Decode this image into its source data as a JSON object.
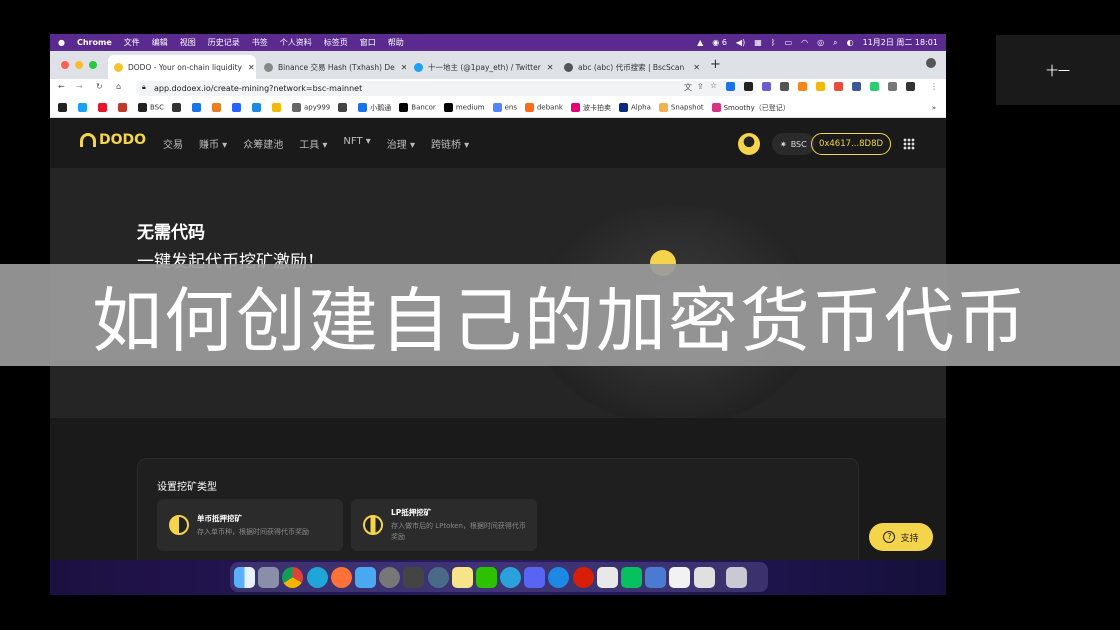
{
  "menubar": {
    "items": [
      "Chrome",
      "文件",
      "编辑",
      "视图",
      "历史记录",
      "书签",
      "个人资料",
      "标签页",
      "窗口",
      "帮助"
    ],
    "wechat_count": "6",
    "datetime": "11月2日 周二  18:01"
  },
  "browser": {
    "tabs": [
      {
        "title": "DODO - Your on-chain liquidity",
        "color": "#f4c430"
      },
      {
        "title": "Binance 交易 Hash (Txhash) De",
        "color": "#666"
      },
      {
        "title": "十一地主 (@1pay_eth) / Twitter",
        "color": "#1da1f2"
      },
      {
        "title": "abc (abc) 代币搜索 | BscScan",
        "color": "#555"
      }
    ],
    "url": "app.dodoex.io/create-mining?network=bsc-mainnet",
    "bookmarks": [
      {
        "label": "BSC",
        "color": "#222"
      },
      {
        "label": "apy999",
        "color": "#666"
      },
      {
        "label": "小鹅通",
        "color": "#1a73e8"
      },
      {
        "label": "Bancor",
        "color": "#000"
      },
      {
        "label": "medium",
        "color": "#000"
      },
      {
        "label": "ens",
        "color": "#5284ff"
      },
      {
        "label": "debank",
        "color": "#ff6b1a"
      },
      {
        "label": "波卡拍卖",
        "color": "#e6007a"
      },
      {
        "label": "Alpha",
        "color": "#0a2a80"
      },
      {
        "label": "Snapshot",
        "color": "#f3b04e"
      },
      {
        "label": "Smoothy（已登记）",
        "color": "#d63384"
      }
    ],
    "bookmarks_more": "»"
  },
  "nav": {
    "logo": "DODO",
    "items": [
      "交易",
      "赚币 ▾",
      "众筹建池",
      "工具 ▾",
      "NFT ▾",
      "治理 ▾",
      "跨链桥 ▾"
    ],
    "network": "BSC",
    "wallet": "0x4617...8D8D"
  },
  "hero": {
    "title": "无需代码",
    "subtitle": "一键发起代币挖矿激励！"
  },
  "mining": {
    "section_title": "设置挖矿类型",
    "options": [
      {
        "title": "单币抵押挖矿",
        "desc": "存入单币种，根据时间获得代币奖励"
      },
      {
        "title": "LP抵押挖矿",
        "desc": "存入做市后的 LPtoken，根据时间获得代币奖励"
      }
    ],
    "support_label": "支持"
  },
  "overlay": {
    "banner_text": "如何创建自己的加密货币代币",
    "side_text": "十一"
  }
}
